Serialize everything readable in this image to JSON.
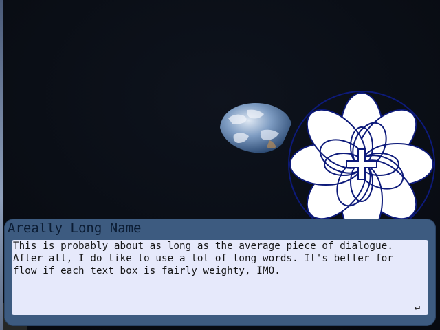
{
  "dialogue": {
    "speaker": "Areally Long Name",
    "lines": [
      "This is probably about as long as the average piece of dialogue.",
      "After all, I do like to use a lot of long words. It's better for",
      "flow if each text box is fairly weighty, IMO."
    ],
    "advance_glyph": "↵"
  },
  "scene": {
    "background": "earthrise-space-backdrop",
    "character_sprite": "white-flower-emblem-icon"
  },
  "colors": {
    "box": "#3d5b80",
    "panel": "#e6e9fb",
    "sprite_outline": "#0d1a7a",
    "sprite_fill": "#ffffff"
  }
}
